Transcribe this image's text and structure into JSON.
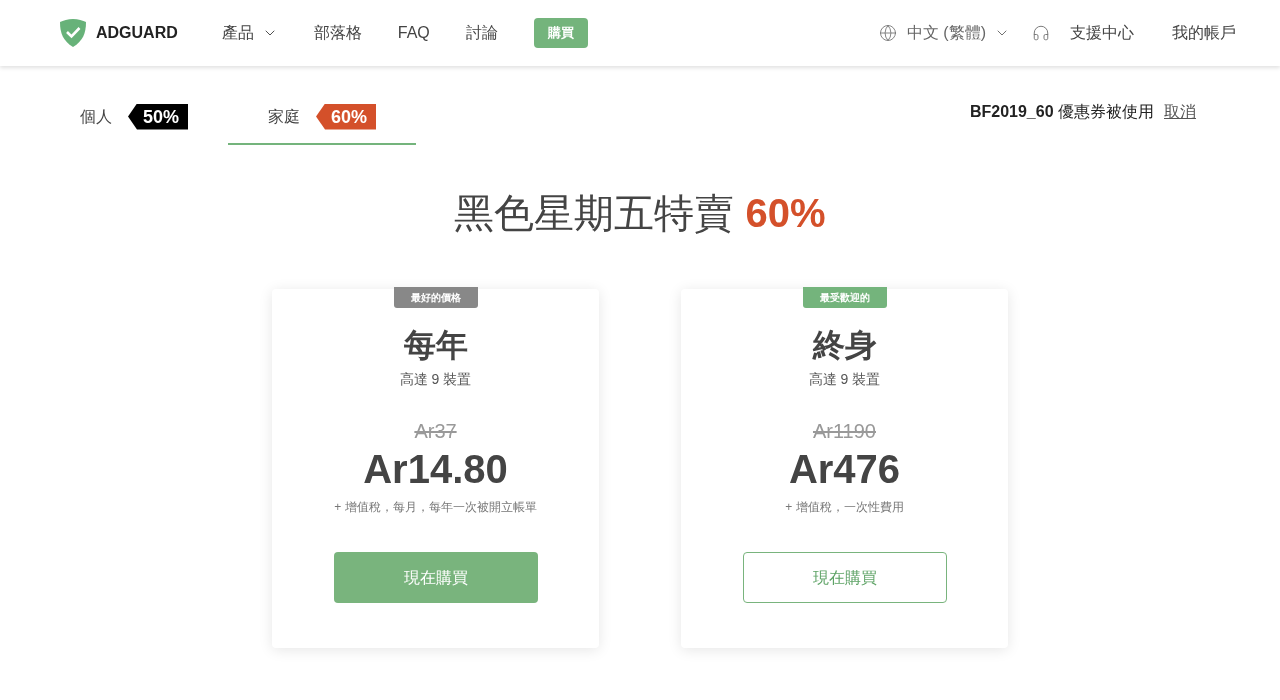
{
  "header": {
    "logo": "ADGUARD",
    "nav": [
      {
        "label": "產品",
        "dropdown": true
      },
      {
        "label": "部落格",
        "dropdown": false
      },
      {
        "label": "FAQ",
        "dropdown": false
      },
      {
        "label": "討論",
        "dropdown": false
      }
    ],
    "buy_button": "購買",
    "language": "中文 (繁體)",
    "support": "支援中心",
    "account": "我的帳戶"
  },
  "tabs": [
    {
      "label": "個人",
      "badge": "50%",
      "color": "#000000",
      "selected": false
    },
    {
      "label": "家庭",
      "badge": "60%",
      "color": "#d4502a",
      "selected": true
    }
  ],
  "coupon": {
    "code": "BF2019_60",
    "text": "優惠券被使用",
    "cancel": "取消"
  },
  "headline": {
    "text": "黑色星期五特賣",
    "highlight": "60%"
  },
  "plans": [
    {
      "badge": "最好的價格",
      "color": "#888888",
      "title": "每年",
      "devices": "高達 9 裝置",
      "old_price": "Ar37",
      "price": "Ar14.80",
      "note": "+ 增值稅，每月，每年一次被開立帳單",
      "button": {
        "label": "現在購買",
        "kind": "filled"
      }
    },
    {
      "badge": "最受歡迎的",
      "color": "#74b47c",
      "title": "終身",
      "devices": "高達 9 裝置",
      "old_price": "Ar1190",
      "price": "Ar476",
      "note": "+ 增值稅，一次性費用",
      "button": {
        "label": "現在購買",
        "kind": "outline"
      }
    }
  ]
}
